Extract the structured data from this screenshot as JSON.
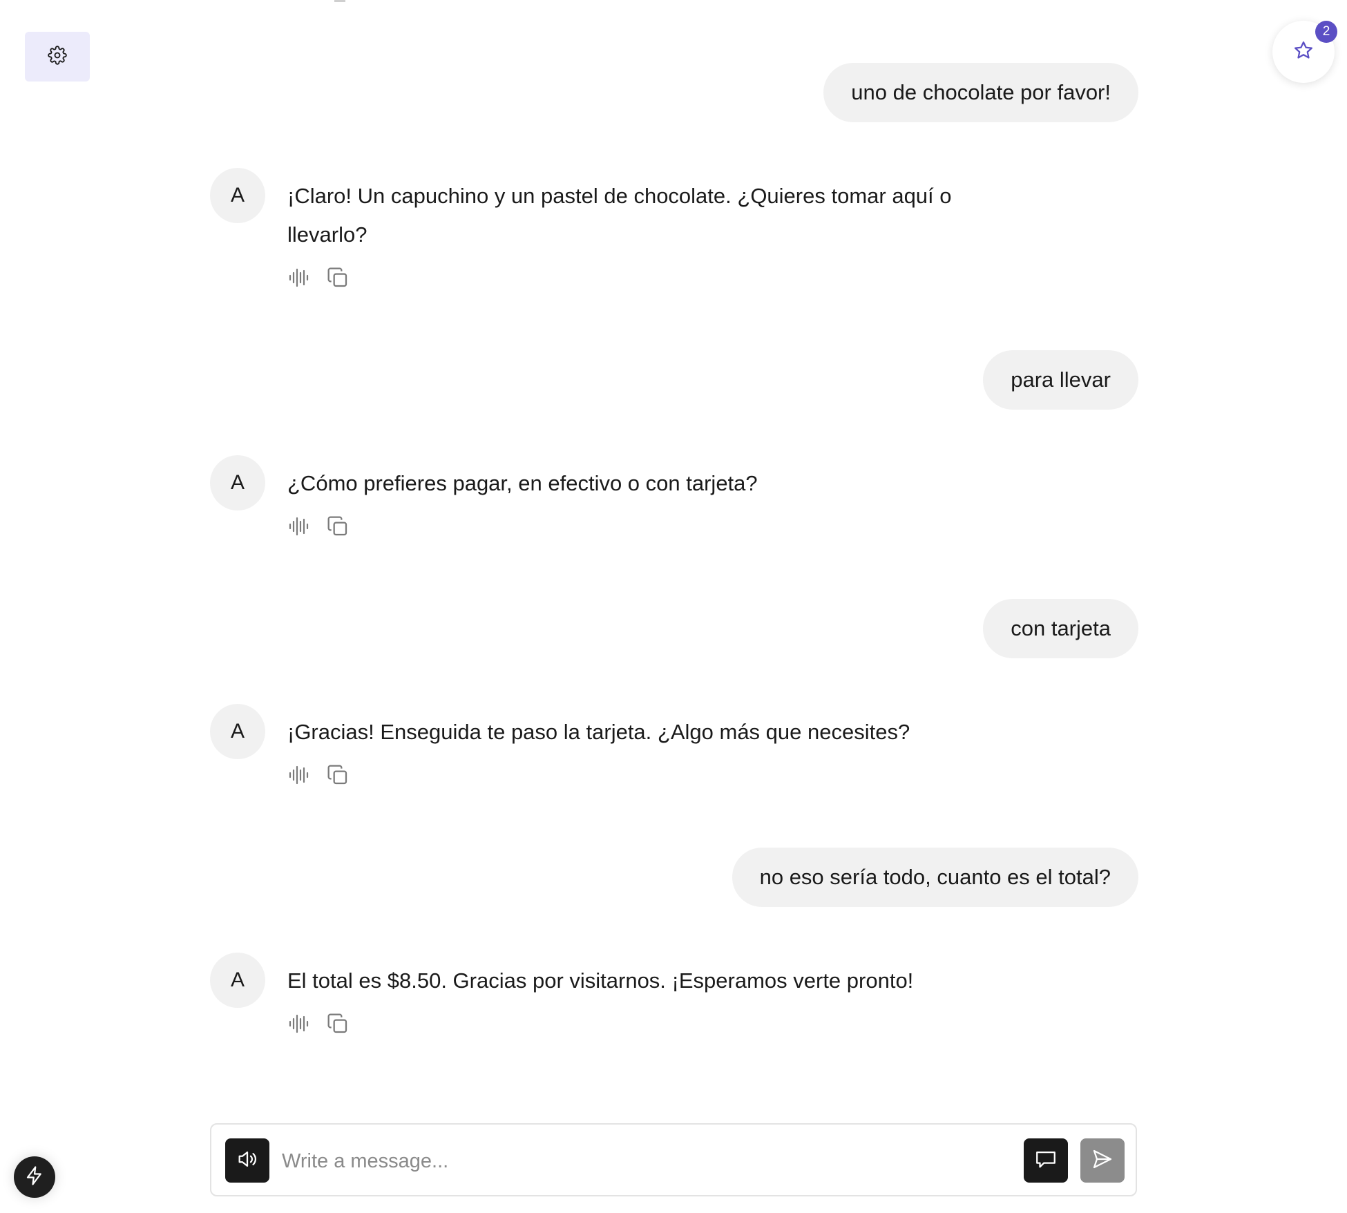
{
  "header": {
    "settings_icon": "gear-icon",
    "favorites_icon": "star-icon",
    "favorites_count": "2"
  },
  "messages": [
    {
      "role": "user",
      "text": "uno de chocolate por favor!"
    },
    {
      "role": "assistant",
      "avatar": "A",
      "text": "¡Claro! Un capuchino y un pastel de chocolate. ¿Quieres tomar aquí o llevarlo?",
      "actions": [
        "audio-wave-icon",
        "copy-icon"
      ]
    },
    {
      "role": "user",
      "text": "para llevar"
    },
    {
      "role": "assistant",
      "avatar": "A",
      "text": "¿Cómo prefieres pagar, en efectivo o con tarjeta?",
      "actions": [
        "audio-wave-icon",
        "copy-icon"
      ]
    },
    {
      "role": "user",
      "text": "con tarjeta"
    },
    {
      "role": "assistant",
      "avatar": "A",
      "text": "¡Gracias! Enseguida te paso la tarjeta. ¿Algo más que necesites?",
      "actions": [
        "audio-wave-icon",
        "copy-icon"
      ]
    },
    {
      "role": "user",
      "text": "no eso sería todo, cuanto es el total?"
    },
    {
      "role": "assistant",
      "avatar": "A",
      "text": "El total es $8.50. Gracias por visitarnos. ¡Esperamos verte pronto!",
      "actions": [
        "audio-wave-icon",
        "copy-icon"
      ]
    }
  ],
  "composer": {
    "placeholder": "Write a message...",
    "value": "",
    "speaker_icon": "speaker-icon",
    "chat_icon": "chat-bubble-icon",
    "send_icon": "send-icon"
  },
  "floating": {
    "quick_action_icon": "bolt-icon"
  }
}
